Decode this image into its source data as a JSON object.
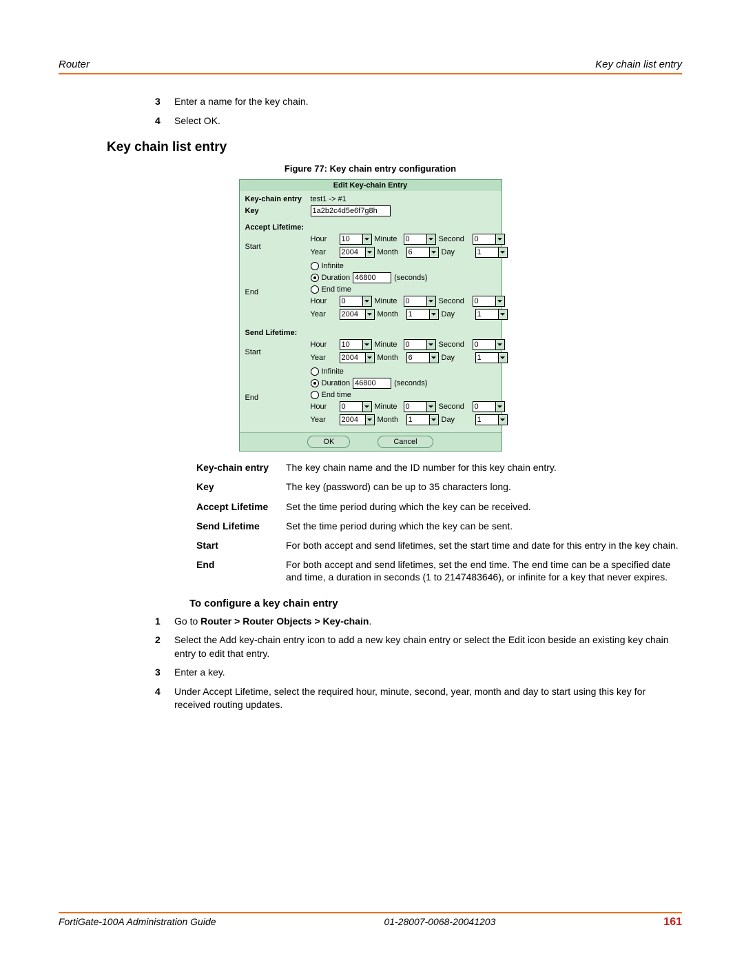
{
  "header": {
    "left": "Router",
    "right": "Key chain list entry"
  },
  "top_steps": [
    {
      "n": "3",
      "text": "Enter a name for the key chain."
    },
    {
      "n": "4",
      "text": "Select OK."
    }
  ],
  "section_title": "Key chain list entry",
  "figure_caption": "Figure 77: Key chain entry configuration",
  "ui": {
    "title": "Edit Key-chain Entry",
    "kc_label": "Key-chain entry",
    "kc_value": "test1 -> #1",
    "key_label": "Key",
    "key_value": "1a2b2c4d5e6f7g8h",
    "accept_label": "Accept Lifetime:",
    "send_label": "Send Lifetime:",
    "start_label": "Start",
    "end_label": "End",
    "hour_label": "Hour",
    "minute_label": "Minute",
    "second_label": "Second",
    "year_label": "Year",
    "month_label": "Month",
    "day_label": "Day",
    "infinite_label": "Infinite",
    "duration_label": "Duration",
    "duration_suffix": "(seconds)",
    "endtime_label": "End time",
    "ok": "OK",
    "cancel": "Cancel",
    "accept": {
      "start": {
        "hour": "10",
        "minute": "0",
        "second": "0",
        "year": "2004",
        "month": "6",
        "day": "1"
      },
      "end": {
        "duration": "46800",
        "hour": "0",
        "minute": "0",
        "second": "0",
        "year": "2004",
        "month": "1",
        "day": "1"
      }
    },
    "send": {
      "start": {
        "hour": "10",
        "minute": "0",
        "second": "0",
        "year": "2004",
        "month": "6",
        "day": "1"
      },
      "end": {
        "duration": "46800",
        "hour": "0",
        "minute": "0",
        "second": "0",
        "year": "2004",
        "month": "1",
        "day": "1"
      }
    }
  },
  "defs": [
    {
      "term": "Key-chain entry",
      "desc": "The key chain name and the ID number for this key chain entry."
    },
    {
      "term": "Key",
      "desc": "The key (password) can be up to 35 characters long."
    },
    {
      "term": "Accept Lifetime",
      "desc": "Set the time period during which the key can be received."
    },
    {
      "term": "Send Lifetime",
      "desc": "Set the time period during which the key can be sent."
    },
    {
      "term": "Start",
      "desc": "For both accept and send lifetimes, set the start time and date for this entry in the key chain."
    },
    {
      "term": "End",
      "desc": "For both accept and send lifetimes, set the end time. The end time can be a specified date and time, a duration in seconds (1 to 2147483646), or infinite for a key that never expires."
    }
  ],
  "subheading": "To configure a key chain entry",
  "steps2": [
    {
      "n": "1",
      "html": "Go to <b>Router > Router Objects > Key-chain</b>."
    },
    {
      "n": "2",
      "html": "Select the Add key-chain entry icon to add a new key chain entry or select the Edit icon beside an existing key chain entry to edit that entry."
    },
    {
      "n": "3",
      "html": "Enter a key."
    },
    {
      "n": "4",
      "html": "Under Accept Lifetime, select the required hour, minute, second, year, month and day to start using this key for received routing updates."
    }
  ],
  "footer": {
    "left": "FortiGate-100A Administration Guide",
    "mid": "01-28007-0068-20041203",
    "page": "161"
  }
}
